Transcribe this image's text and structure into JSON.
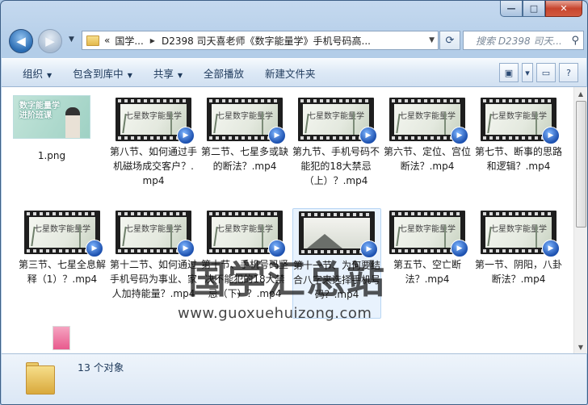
{
  "window": {
    "minimize_glyph": "—",
    "maximize_glyph": "□",
    "close_glyph": "✕"
  },
  "address": {
    "prefix": "«",
    "crumbs": [
      "国学...",
      "D2398 司天喜老师《数字能量学》手机号码高..."
    ],
    "search_placeholder": "搜索 D2398 司天..."
  },
  "toolbar": {
    "organize": "组织",
    "include_in_library": "包含到库中",
    "share": "共享",
    "play_all": "全部播放",
    "new_folder": "新建文件夹"
  },
  "thumbnail_text": {
    "png_title_line1": "数字能量学",
    "png_title_line2": "进阶班课",
    "video_title": "七星数字能量学"
  },
  "files": [
    {
      "name": "1.png",
      "kind": "png"
    },
    {
      "name": "第八节、如何通过手机磁场成交客户？.mp4",
      "kind": "mp4"
    },
    {
      "name": "第二节、七星多或缺的断法？.mp4",
      "kind": "mp4"
    },
    {
      "name": "第九节、手机号码不能犯的18大禁忌（上）？.mp4",
      "kind": "mp4"
    },
    {
      "name": "第六节、定位、宫位断法？.mp4",
      "kind": "mp4"
    },
    {
      "name": "第七节、断事的思路和逻辑？.mp4",
      "kind": "mp4"
    },
    {
      "name": "第三节、七星全息解释（1）？.mp4",
      "kind": "mp4"
    },
    {
      "name": "第十二节、如何通过手机号码为事业、家人加持能量？.mp4",
      "kind": "mp4"
    },
    {
      "name": "第十节、手机号码坚决不能犯的18大禁忌（下）？.mp4",
      "kind": "mp4"
    },
    {
      "name": "第十一节、为何要结合八字来选择手机号码？.mp4",
      "kind": "mp4"
    },
    {
      "name": "第五节、空亡断法？.mp4",
      "kind": "mp4"
    },
    {
      "name": "第一节、阴阳，八卦断法？.mp4",
      "kind": "mp4"
    }
  ],
  "watermark": {
    "title": "国学汇总站",
    "url": "www.guoxuehuizong.com"
  },
  "status": {
    "count": "13 个对象"
  }
}
